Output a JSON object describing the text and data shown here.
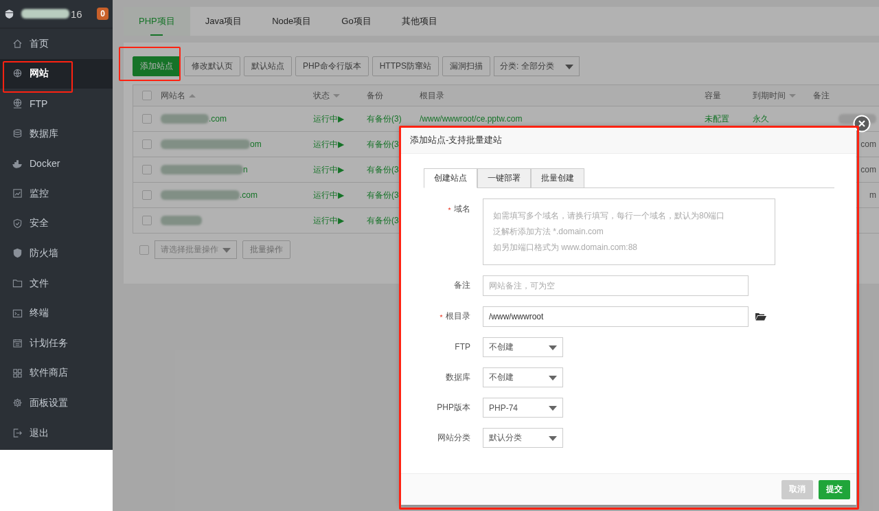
{
  "sidebar": {
    "user_suffix": "16",
    "badge": "0",
    "items": [
      {
        "label": "首页",
        "selected": false
      },
      {
        "label": "网站",
        "selected": true
      },
      {
        "label": "FTP",
        "selected": false
      },
      {
        "label": "数据库",
        "selected": false
      },
      {
        "label": "Docker",
        "selected": false
      },
      {
        "label": "监控",
        "selected": false
      },
      {
        "label": "安全",
        "selected": false
      },
      {
        "label": "防火墙",
        "selected": false
      },
      {
        "label": "文件",
        "selected": false
      },
      {
        "label": "终端",
        "selected": false
      },
      {
        "label": "计划任务",
        "selected": false
      },
      {
        "label": "软件商店",
        "selected": false
      },
      {
        "label": "面板设置",
        "selected": false
      },
      {
        "label": "退出",
        "selected": false
      }
    ]
  },
  "tabs": [
    {
      "label": "PHP项目",
      "selected": true
    },
    {
      "label": "Java项目",
      "selected": false
    },
    {
      "label": "Node项目",
      "selected": false
    },
    {
      "label": "Go项目",
      "selected": false
    },
    {
      "label": "其他项目",
      "selected": false
    }
  ],
  "toolbar": {
    "buttons": [
      {
        "label": "添加站点",
        "kind": "primary"
      },
      {
        "label": "修改默认页",
        "kind": "plain"
      },
      {
        "label": "默认站点",
        "kind": "plain"
      },
      {
        "label": "PHP命令行版本",
        "kind": "plain"
      },
      {
        "label": "HTTPS防窜站",
        "kind": "plain"
      },
      {
        "label": "漏洞扫描",
        "kind": "plain"
      }
    ],
    "category": "分类: 全部分类"
  },
  "table": {
    "all_checked": false,
    "columns": [
      "网站名",
      "状态",
      "备份",
      "根目录",
      "容量",
      "到期时间",
      "备注"
    ],
    "rows": [
      {
        "name": ".com",
        "status": "运行中▶",
        "backup": "有备份(3)",
        "root": "/www/wwwroot/ce.pptw.com",
        "size": "未配置",
        "expire": "永久",
        "checked": false
      },
      {
        "name": "om",
        "status": "运行中▶",
        "backup": "有备份(3",
        "remark": "com",
        "checked": false
      },
      {
        "name": "n",
        "status": "运行中▶",
        "backup": "有备份(3",
        "remark": "com",
        "checked": false
      },
      {
        "name": ".com",
        "status": "运行中▶",
        "backup": "有备份(3",
        "remark": "m",
        "checked": false
      },
      {
        "status": "运行中▶",
        "backup": "有备份(3",
        "checked": false
      }
    ]
  },
  "batch": {
    "checked": false,
    "placeholder": "请选择批量操作",
    "button": "批量操作"
  },
  "dialog": {
    "title": "添加站点-支持批量建站",
    "tabs": [
      {
        "label": "创建站点",
        "selected": true
      },
      {
        "label": "一键部署",
        "selected": false
      },
      {
        "label": "批量创建",
        "selected": false
      }
    ],
    "fields": [
      {
        "kind": "textarea",
        "label": "域名",
        "required": true,
        "placeholder": [
          "如需填写多个域名，请换行填写，每行一个域名，默认为80端口",
          "泛解析添加方法 *.domain.com",
          "如另加端口格式为 www.domain.com:88"
        ]
      },
      {
        "kind": "input",
        "label": "备注",
        "required": false,
        "placeholder": "网站备注，可为空"
      },
      {
        "kind": "path",
        "label": "根目录",
        "required": true,
        "value": "/www/wwwroot"
      },
      {
        "kind": "select",
        "label": "FTP",
        "required": false,
        "value": "不创建"
      },
      {
        "kind": "select",
        "label": "数据库",
        "required": false,
        "value": "不创建"
      },
      {
        "kind": "select",
        "label": "PHP版本",
        "required": false,
        "value": "PHP-74"
      },
      {
        "kind": "select",
        "label": "网站分类",
        "required": false,
        "value": "默认分类"
      }
    ],
    "cancel": "取消",
    "submit": "提交"
  }
}
